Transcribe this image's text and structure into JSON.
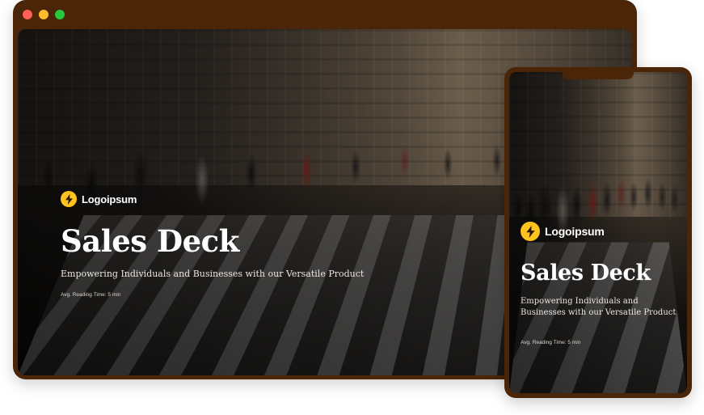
{
  "frame": {
    "color": "#4a2508",
    "window_controls": [
      "close",
      "minimize",
      "maximize"
    ]
  },
  "brand": {
    "name": "Logoipsum",
    "accent_color": "#ffc31f",
    "icon": "lightning-bolt-icon"
  },
  "desktop": {
    "title": "Sales Deck",
    "subtitle": "Empowering Individuals and Businesses with our Versatile Product",
    "reading_time": "Avg. Reading Time: 5 min"
  },
  "mobile": {
    "title": "Sales Deck",
    "subtitle": "Empowering Individuals and Businesses with our Versatile Product",
    "reading_time": "Avg. Reading Time: 5 min"
  }
}
